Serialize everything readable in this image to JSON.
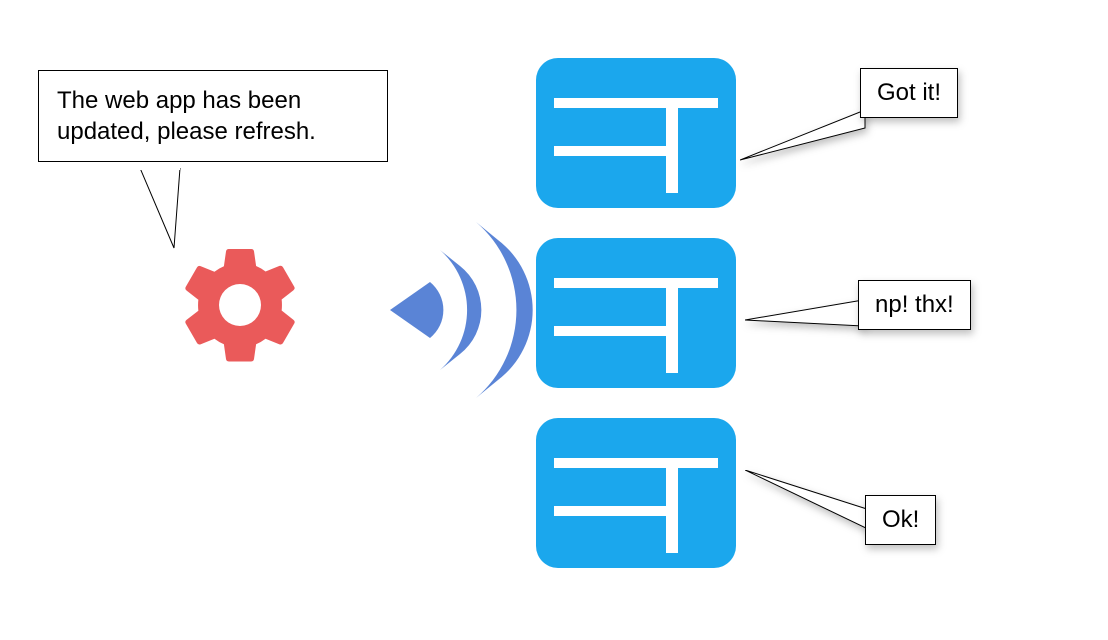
{
  "gear_bubble": "The web app has been updated, please refresh.",
  "clients": [
    {
      "reply": "Got it!"
    },
    {
      "reply": "np! thx!"
    },
    {
      "reply": "Ok!"
    }
  ],
  "colors": {
    "gear": "#ea5a5a",
    "broadcast": "#5a84d6",
    "client": "#1ba7ed"
  }
}
